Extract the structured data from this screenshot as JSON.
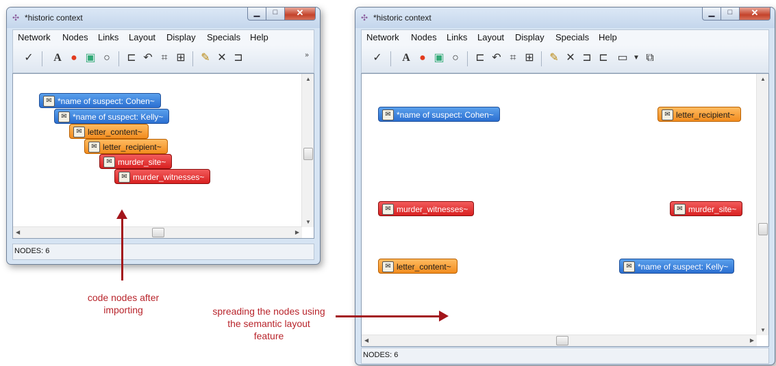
{
  "left_window": {
    "title": "*historic context",
    "menu": [
      "Network",
      "Nodes",
      "Links",
      "Layout",
      "Display",
      "Specials",
      "Help"
    ],
    "toolbar_overflow": "»",
    "status": "NODES: 6",
    "nodes": [
      {
        "label": "*name of suspect: Cohen~",
        "color": "blue"
      },
      {
        "label": "*name of suspect: Kelly~",
        "color": "blue"
      },
      {
        "label": "letter_content~",
        "color": "orange"
      },
      {
        "label": "letter_recipient~",
        "color": "orange"
      },
      {
        "label": "murder_site~",
        "color": "red"
      },
      {
        "label": "murder_witnesses~",
        "color": "red"
      }
    ]
  },
  "right_window": {
    "title": "*historic context",
    "menu": [
      "Network",
      "Nodes",
      "Links",
      "Layout",
      "Display",
      "Specials",
      "Help"
    ],
    "status": "NODES: 6",
    "nodes": [
      {
        "label": "*name of suspect: Cohen~",
        "color": "blue"
      },
      {
        "label": "letter_recipient~",
        "color": "orange"
      },
      {
        "label": "murder_witnesses~",
        "color": "red"
      },
      {
        "label": "murder_site~",
        "color": "red"
      },
      {
        "label": "letter_content~",
        "color": "orange"
      },
      {
        "label": "*name of suspect: Kelly~",
        "color": "blue"
      }
    ]
  },
  "annotations": {
    "left": "code nodes after importing",
    "right": "spreading the nodes using the semantic layout feature"
  },
  "colors": {
    "node_blue": "#3a82e0",
    "node_orange": "#f7a03c",
    "node_red": "#e03030",
    "annotation": "#b8242b"
  },
  "icons": {
    "app": "network-icon",
    "toolbar": [
      "check-icon",
      "font-icon",
      "color-wheel-icon",
      "image-icon",
      "speech-bubble-icon",
      "tree-layout-icon",
      "undo-icon",
      "network-grid-icon",
      "network-select-icon",
      "new-node-icon",
      "delete-icon",
      "link-icon",
      "unlink-icon",
      "frame-icon",
      "dropdown-icon",
      "copy-icon"
    ]
  }
}
